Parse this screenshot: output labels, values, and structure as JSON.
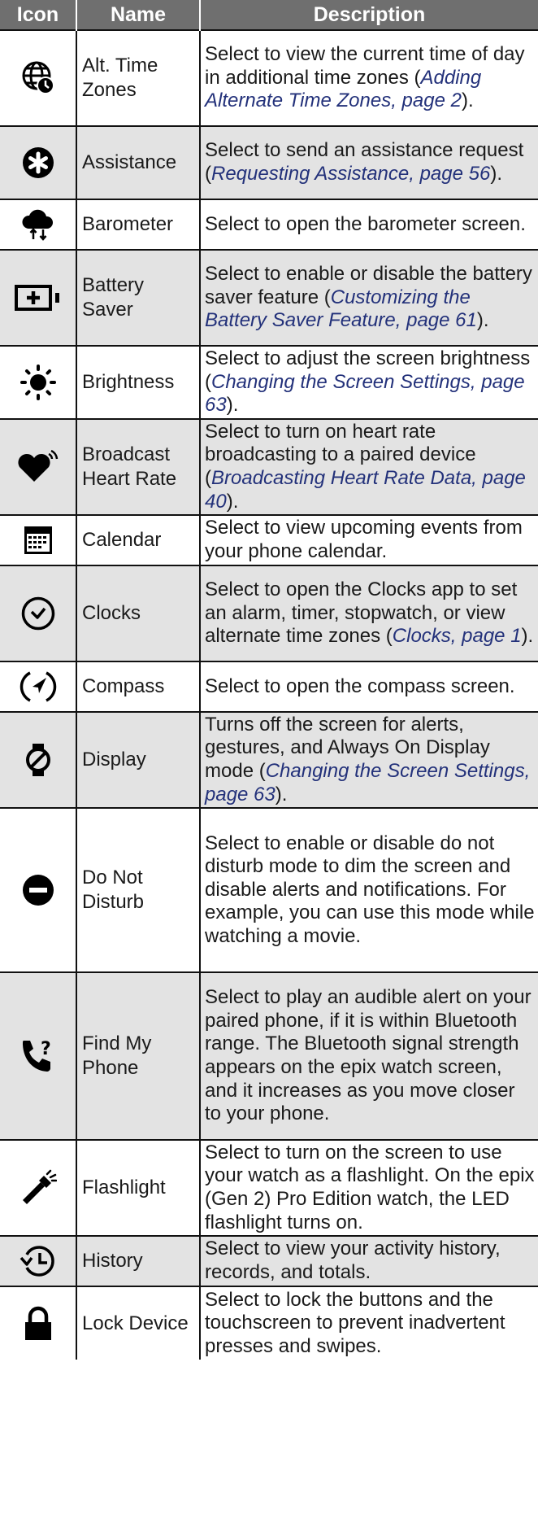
{
  "header": {
    "icon": "Icon",
    "name": "Name",
    "description": "Description"
  },
  "rows": [
    {
      "icon": "globe-clock-icon",
      "name": "Alt. Time Zones",
      "before": "Select to view the current time of day in additional time zones (",
      "link": "Adding Alternate Time Zones, page 2",
      "after": ")."
    },
    {
      "icon": "assistance-icon",
      "name": "Assistance",
      "before": "Select to send an assistance request (",
      "link": "Requesting Assistance, page 56",
      "after": ")."
    },
    {
      "icon": "barometer-icon",
      "name": "Barometer",
      "before": "Select to open the barometer screen.",
      "link": "",
      "after": ""
    },
    {
      "icon": "battery-saver-icon",
      "name": "Battery Saver",
      "before": "Select to enable or disable the battery saver feature (",
      "link": "Customizing the Battery Saver Feature, page 61",
      "after": ")."
    },
    {
      "icon": "brightness-icon",
      "name": "Brightness",
      "before": "Select to adjust the screen brightness (",
      "link": "Changing the Screen Settings, page 63",
      "after": ")."
    },
    {
      "icon": "heart-broadcast-icon",
      "name": "Broadcast Heart Rate",
      "before": "Select to turn on heart rate broadcasting to a paired device (",
      "link": "Broadcasting Heart Rate Data, page 40",
      "after": ")."
    },
    {
      "icon": "calendar-icon",
      "name": "Calendar",
      "before": "Select to view upcoming events from your phone calendar.",
      "link": "",
      "after": ""
    },
    {
      "icon": "clock-icon",
      "name": "Clocks",
      "before": "Select to open the Clocks app to set an alarm, timer, stopwatch, or view alternate time zones (",
      "link": "Clocks, page 1",
      "after": ")."
    },
    {
      "icon": "compass-icon",
      "name": "Compass",
      "before": "Select to open the compass screen.",
      "link": "",
      "after": ""
    },
    {
      "icon": "display-off-icon",
      "name": "Display",
      "before": "Turns off the screen for alerts, gestures, and Always On Display mode (",
      "link": "Changing the Screen Settings, page 63",
      "after": ")."
    },
    {
      "icon": "do-not-disturb-icon",
      "name": "Do Not Disturb",
      "before": "Select to enable or disable do not disturb mode to dim the screen and disable alerts and notifications. For example, you can use this mode while watching a movie.",
      "link": "",
      "after": ""
    },
    {
      "icon": "find-phone-icon",
      "name": "Find My Phone",
      "before": "Select to play an audible alert on your paired phone, if it is within Bluetooth range. The Bluetooth signal strength appears on the epix watch screen, and it increases as you move closer to your phone.",
      "link": "",
      "after": ""
    },
    {
      "icon": "flashlight-icon",
      "name": "Flashlight",
      "before": "Select to turn on the screen to use your watch as a flashlight. On the epix (Gen 2) Pro Edition watch, the LED flashlight turns on.",
      "link": "",
      "after": ""
    },
    {
      "icon": "history-icon",
      "name": "History",
      "before": "Select to view your activity history, records, and totals.",
      "link": "",
      "after": ""
    },
    {
      "icon": "lock-icon",
      "name": "Lock Device",
      "before": "Select to lock the buttons and the touchscreen to prevent inadvertent presses and swipes.",
      "link": "",
      "after": ""
    }
  ]
}
